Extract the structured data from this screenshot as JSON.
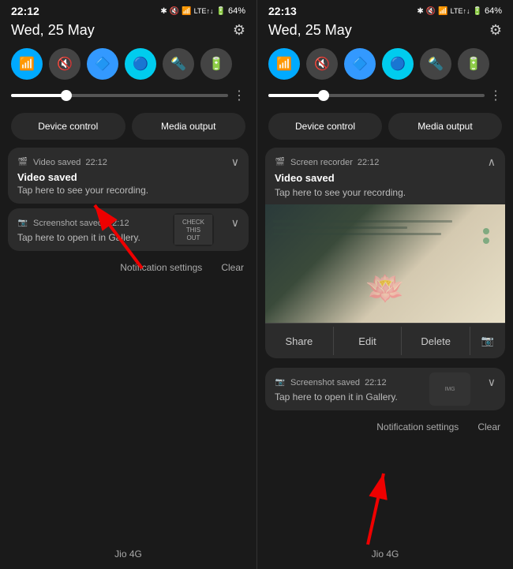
{
  "panel_left": {
    "time": "22:12",
    "date": "Wed, 25 May",
    "status_icons": [
      "🔵",
      "🔇",
      "📶",
      "LTE",
      "64%"
    ],
    "toggles": [
      {
        "icon": "📶",
        "active": true,
        "label": "wifi"
      },
      {
        "icon": "🔇",
        "active": true,
        "label": "mute"
      },
      {
        "icon": "🔷",
        "active": true,
        "label": "bluetooth"
      },
      {
        "icon": "🔵",
        "active": true,
        "label": "data"
      },
      {
        "icon": "🔦",
        "active": false,
        "label": "flashlight"
      },
      {
        "icon": "🔋",
        "active": false,
        "label": "battery"
      }
    ],
    "device_control": "Device control",
    "media_output": "Media output",
    "notification_1": {
      "app": "Video saved",
      "time": "22:12",
      "title": "Video saved",
      "body": "Tap here to see your recording."
    },
    "notification_2": {
      "app": "Screenshot saved",
      "time": "22:12",
      "title": "Screenshot saved",
      "body": "Tap here to open it in Gallery."
    },
    "action_notification_settings": "Notification settings",
    "action_clear": "Clear",
    "bottom_label": "Jio 4G"
  },
  "panel_right": {
    "time": "22:13",
    "date": "Wed, 25 May",
    "device_control": "Device control",
    "media_output": "Media output",
    "notification_expanded": {
      "app": "Screen recorder",
      "app_time": "22:12",
      "title": "Video saved",
      "body": "Tap here to see your recording.",
      "actions": [
        "Share",
        "Edit",
        "Delete"
      ]
    },
    "notification_2": {
      "app": "Screenshot saved",
      "time": "22:12",
      "body": "Tap here to open it in Gallery."
    },
    "action_notification_settings": "Notification settings",
    "action_clear": "Clear",
    "bottom_label": "Jio 4G"
  }
}
